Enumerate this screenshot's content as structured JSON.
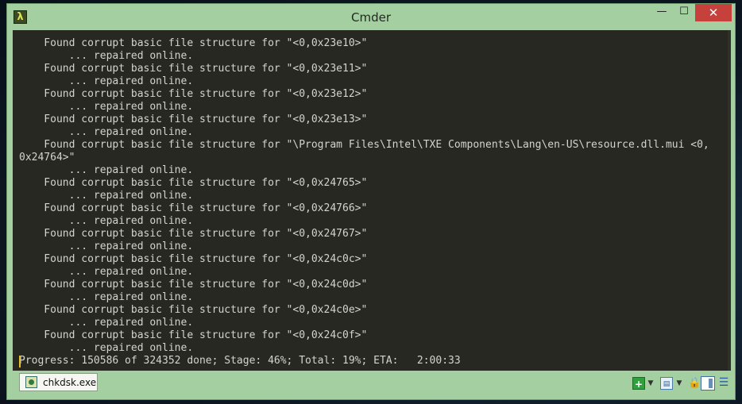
{
  "window": {
    "title": "Cmder",
    "app_icon": "λ",
    "minimize_glyph": "—",
    "maximize_glyph": "☐",
    "close_glyph": "✕"
  },
  "console": {
    "lines": [
      "    Found corrupt basic file structure for \"<0,0x23e10>\"",
      "        ... repaired online.",
      "    Found corrupt basic file structure for \"<0,0x23e11>\"",
      "        ... repaired online.",
      "    Found corrupt basic file structure for \"<0,0x23e12>\"",
      "        ... repaired online.",
      "    Found corrupt basic file structure for \"<0,0x23e13>\"",
      "        ... repaired online.",
      "    Found corrupt basic file structure for \"\\Program Files\\Intel\\TXE Components\\Lang\\en-US\\resource.dll.mui <0,",
      "0x24764>\"",
      "        ... repaired online.",
      "    Found corrupt basic file structure for \"<0,0x24765>\"",
      "        ... repaired online.",
      "    Found corrupt basic file structure for \"<0,0x24766>\"",
      "        ... repaired online.",
      "    Found corrupt basic file structure for \"<0,0x24767>\"",
      "        ... repaired online.",
      "    Found corrupt basic file structure for \"<0,0x24c0c>\"",
      "        ... repaired online.",
      "    Found corrupt basic file structure for \"<0,0x24c0d>\"",
      "        ... repaired online.",
      "    Found corrupt basic file structure for \"<0,0x24c0e>\"",
      "        ... repaired online.",
      "    Found corrupt basic file structure for \"<0,0x24c0f>\"",
      "        ... repaired online.",
      "Progress: 150586 of 324352 done; Stage: 46%; Total: 19%; ETA:   2:00:33"
    ]
  },
  "statusbar": {
    "tab_label": "chkdsk.exe",
    "new_tab_glyph": "+",
    "dropdown_glyph": "▼",
    "panel_glyph": "▤",
    "lock_glyph": "🔒",
    "menu_glyph": "☰"
  },
  "colors": {
    "frame": "#a4cfa0",
    "console_bg": "#272822",
    "console_text": "#d4d4cc",
    "close_button": "#c7413c",
    "caret": "#e6c02f"
  }
}
